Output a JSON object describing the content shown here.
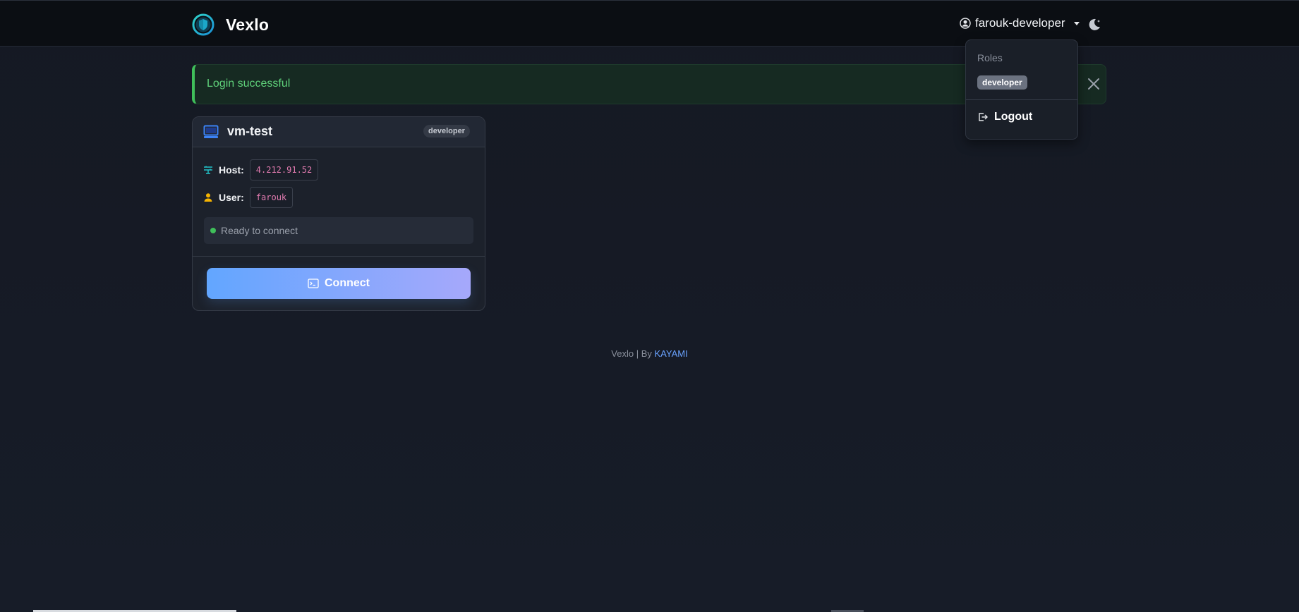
{
  "brand": {
    "name": "Vexlo"
  },
  "user_menu": {
    "username": "farouk-developer"
  },
  "alert": {
    "message": "Login successful"
  },
  "dropdown": {
    "header": "Roles",
    "roles": [
      "developer"
    ],
    "logout_label": "Logout"
  },
  "vm_card": {
    "name": "vm-test",
    "role": "developer",
    "host_label": "Host:",
    "host_value": "4.212.91.52",
    "user_label": "User:",
    "user_value": "farouk",
    "status_text": "Ready to connect",
    "connect_label": "Connect"
  },
  "footer": {
    "prefix": "Vexlo | By ",
    "link_text": "KAYAMI"
  },
  "colors": {
    "accent": "#62a6ff",
    "success": "#3fbf5a",
    "code_text": "#e27bb0"
  }
}
